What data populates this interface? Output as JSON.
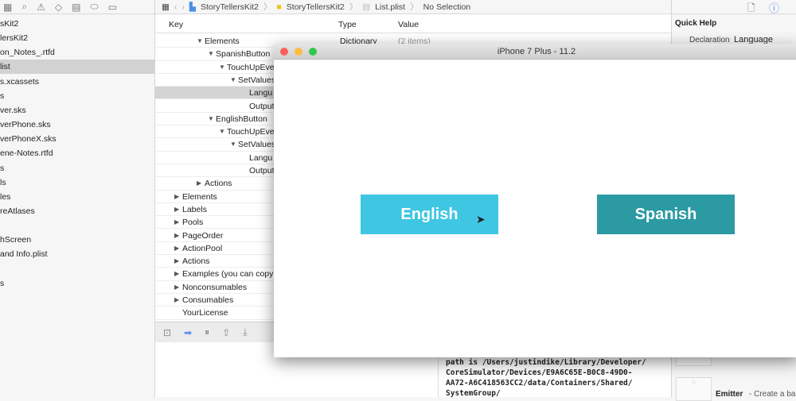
{
  "navigator": {
    "toolbar_icons": [
      "folder-icon",
      "search-icon",
      "warning-icon",
      "diamond-icon",
      "grid-icon",
      "tag-icon",
      "comment-icon"
    ],
    "items": [
      "sKit2",
      "lersKit2",
      "on_Notes_.rtfd",
      "list",
      "s.xcassets",
      "s",
      "ver.sks",
      "verPhone.sks",
      "verPhoneX.sks",
      "ene-Notes.rtfd",
      "s",
      "ls",
      "les",
      "reAtlases",
      "",
      "hScreen",
      "and Info.plist",
      "",
      "s"
    ],
    "selected_index": 3
  },
  "breadcrumb": [
    "StoryTellersKit2",
    "StoryTellersKit2",
    "List.plist",
    "No Selection"
  ],
  "plist": {
    "headers": {
      "key": "Key",
      "type": "Type",
      "value": "Value"
    },
    "rows": [
      {
        "key": "Elements",
        "disc": "open",
        "level": 3,
        "type": "Dictionary",
        "value": "(2 items)"
      },
      {
        "key": "SpanishButton",
        "disc": "open",
        "level": 4
      },
      {
        "key": "TouchUpEve",
        "disc": "open",
        "level": 5
      },
      {
        "key": "SetValues",
        "disc": "open",
        "level": 6
      },
      {
        "key": "Langu",
        "disc": "",
        "level": 7,
        "selected": true
      },
      {
        "key": "OutputVa",
        "disc": "",
        "level": 7
      },
      {
        "key": "EnglishButton",
        "disc": "open",
        "level": 4
      },
      {
        "key": "TouchUpEve",
        "disc": "open",
        "level": 5
      },
      {
        "key": "SetValues",
        "disc": "open",
        "level": 6
      },
      {
        "key": "Langu",
        "disc": "",
        "level": 7
      },
      {
        "key": "OutputVa",
        "disc": "",
        "level": 7
      },
      {
        "key": "Actions",
        "disc": "closed",
        "level": 3
      },
      {
        "key": "Elements",
        "disc": "closed",
        "level": 1
      },
      {
        "key": "Labels",
        "disc": "closed",
        "level": 1
      },
      {
        "key": "Pools",
        "disc": "closed",
        "level": 1
      },
      {
        "key": "PageOrder",
        "disc": "closed",
        "level": 1
      },
      {
        "key": "ActionPool",
        "disc": "closed",
        "level": 1
      },
      {
        "key": "Actions",
        "disc": "closed",
        "level": 1
      },
      {
        "key": "Examples (you can copy",
        "disc": "closed",
        "level": 1
      },
      {
        "key": "Nonconsumables",
        "disc": "closed",
        "level": 1
      },
      {
        "key": "Consumables",
        "disc": "closed",
        "level": 1
      },
      {
        "key": "YourLicense",
        "disc": "",
        "level": 1
      }
    ]
  },
  "inspector": {
    "title": "Quick Help",
    "declaration_label": "Declaration",
    "declaration_value": "Language",
    "emitter_name": "Emitter",
    "emitter_desc": "- Create a bas"
  },
  "simulator": {
    "title": "iPhone 7 Plus - 11.2",
    "buttons": [
      {
        "label": "English",
        "color": "#3ec6e3"
      },
      {
        "label": "Spanish",
        "color": "#2b9aa3"
      }
    ]
  },
  "console": "path is /Users/justindike/Library/Developer/\nCoreSimulator/Devices/E9A6C65E-B0C8-49D0-\nAA72-A6C418563CC2/data/Containers/Shared/\nSystemGroup/"
}
